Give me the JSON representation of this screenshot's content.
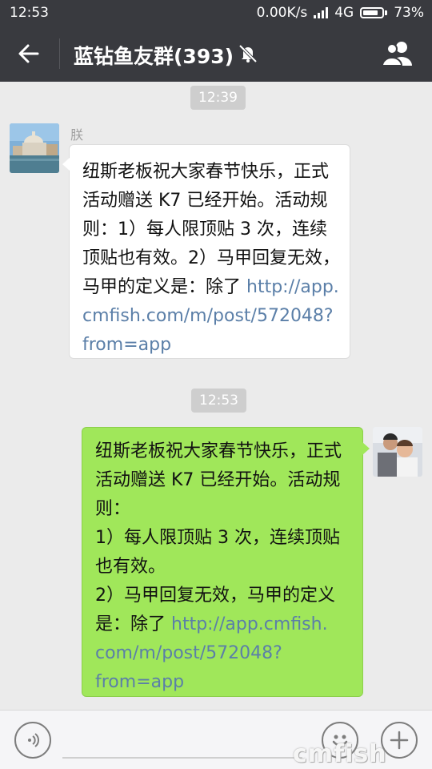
{
  "status_bar": {
    "time": "12:53",
    "net_speed": "0.00K/s",
    "network": "4G",
    "battery": "73%",
    "battery_level": 0.73
  },
  "header": {
    "title": "蓝钻鱼友群(393)",
    "back_icon": "arrow-left-icon",
    "mute_icon": "bell-muted-icon",
    "members_icon": "group-members-icon"
  },
  "chat": {
    "time_chips": [
      "12:39",
      "12:53"
    ],
    "messages": [
      {
        "side": "left",
        "sender": "朕",
        "lines": [
          {
            "text": "纽斯老板祝大家春节快乐，正式"
          },
          {
            "text": "活动赠送 K7 已经开始。活动规"
          },
          {
            "text": "则：1）每人限顶贴 3 次，连续"
          },
          {
            "text": "顶贴也有效。2）马甲回复无效，"
          },
          {
            "text": "马甲的定义是：除了 ",
            "link": "http://app."
          },
          {
            "link": "cmfish.com/m/post/572048?"
          },
          {
            "link": "from=app"
          }
        ]
      },
      {
        "side": "right",
        "lines": [
          {
            "text": "纽斯老板祝大家春节快乐，正式"
          },
          {
            "text": "活动赠送 K7 已经开始。活动规"
          },
          {
            "text": "则："
          },
          {
            "text": "1）每人限顶贴 3 次，连续顶贴"
          },
          {
            "text": "也有效。"
          },
          {
            "text": "2）马甲回复无效，马甲的定义"
          },
          {
            "text": "是：除了 ",
            "link": "http://app.cmfish."
          },
          {
            "link": "com/m/post/572048?"
          },
          {
            "link": "from=app"
          }
        ]
      }
    ]
  },
  "input_bar": {
    "voice_icon": "voice-input-icon",
    "emoji_icon": "emoji-icon",
    "plus_icon": "plus-icon",
    "watermark": "cmfish"
  },
  "colors": {
    "bar": "#393a3f",
    "background": "#ebebeb",
    "bubble_in": "#ffffff",
    "bubble_out": "#a0e75a",
    "link": "#5b7fa8"
  }
}
